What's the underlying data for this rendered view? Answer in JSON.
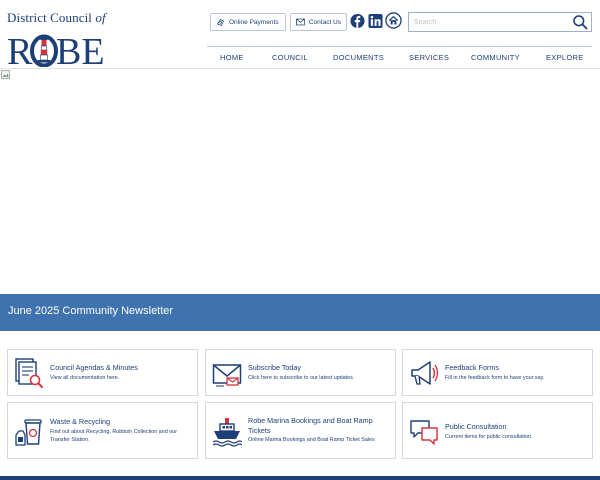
{
  "logo": {
    "line1_prefix": "District Council ",
    "line1_suffix": "of",
    "word": "ROBE"
  },
  "header": {
    "online_payments": "Online Payments",
    "contact_us": "Contact Us",
    "social": [
      "facebook-icon",
      "linkedin-icon",
      "home-icon"
    ],
    "search_placeholder": "Search"
  },
  "nav": {
    "items": [
      "HOME",
      "COUNCIL",
      "DOCUMENTS",
      "SERVICES",
      "COMMUNITY",
      "EXPLORE"
    ]
  },
  "banner": {
    "text": "June 2025 Community Newsletter"
  },
  "cards": [
    {
      "icon": "documents-search-icon",
      "title": "Council Agendas & Minutes",
      "desc": "View all documentation here."
    },
    {
      "icon": "envelope-icon",
      "title": "Subscribe Today",
      "desc": "Click here to subscribe to our latest updates."
    },
    {
      "icon": "megaphone-icon",
      "title": "Feedback Forms",
      "desc": "Fill in the feedback form to have your say."
    },
    {
      "icon": "recycling-bin-icon",
      "title": "Waste & Recycling",
      "desc": "Find out about Recycling, Rubbish Collection and our Transfer Station."
    },
    {
      "icon": "boat-icon",
      "title": "Robe Marina Bookings and Boat Ramp Tickets",
      "desc": "Online Marina Bookings and Boat Ramp Ticket Sales"
    },
    {
      "icon": "speech-bubbles-icon",
      "title": "Public Consultation",
      "desc": "Current items for public consultation."
    }
  ],
  "colors": {
    "navy": "#1d3f77",
    "banner_blue": "#3f72ae",
    "accent_red": "#d6323b",
    "border": "#cfd8e3"
  }
}
